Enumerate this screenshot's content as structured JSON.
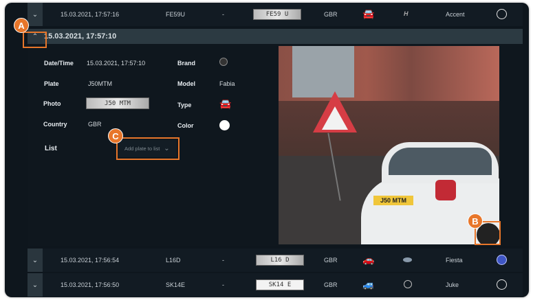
{
  "rows_top": [
    {
      "datetime": "15.03.2021, 17:57:16",
      "plate": "FE59U",
      "list": "-",
      "plate_photo": "FE59 U",
      "country": "GBR",
      "type_icon": "sedan-icon",
      "brand_icon": "hyundai-logo-icon",
      "model": "Accent",
      "color": "#ffffff",
      "color_filled": false
    }
  ],
  "expanded": {
    "datetime_header": "15.03.2021, 17:57:10",
    "labels": {
      "datetime": "Date/Time",
      "plate": "Plate",
      "photo": "Photo",
      "country": "Country",
      "list": "List",
      "brand": "Brand",
      "model": "Model",
      "type": "Type",
      "color": "Color"
    },
    "values": {
      "datetime": "15.03.2021, 17:57:10",
      "plate": "J50MTM",
      "photo": "J50 MTM",
      "country": "GBR",
      "brand_icon": "skoda-logo-icon",
      "model": "Fabia",
      "type_icon": "hatchback-icon",
      "color": "#ffffff"
    },
    "list_dropdown": {
      "placeholder": "Add plate to list"
    },
    "photo_plate_text": "J50 MTM"
  },
  "rows_bottom": [
    {
      "datetime": "15.03.2021, 17:56:54",
      "plate": "L16D",
      "list": "-",
      "plate_photo": "L16 D",
      "country": "GBR",
      "type_icon": "hatchback-icon",
      "brand_icon": "ford-logo-icon",
      "model": "Fiesta",
      "color": "#3f56c4",
      "color_filled": true
    },
    {
      "datetime": "15.03.2021, 17:56:50",
      "plate": "SK14E",
      "list": "-",
      "plate_photo": "SK14 E",
      "country": "GBR",
      "type_icon": "suv-icon",
      "brand_icon": "nissan-logo-icon",
      "model": "Juke",
      "color": "#ffffff",
      "color_filled": false
    }
  ],
  "annotations": {
    "a": "A",
    "b": "B",
    "c": "C"
  },
  "colors": {
    "accent": "#e8762a",
    "background": "#0e161d"
  }
}
